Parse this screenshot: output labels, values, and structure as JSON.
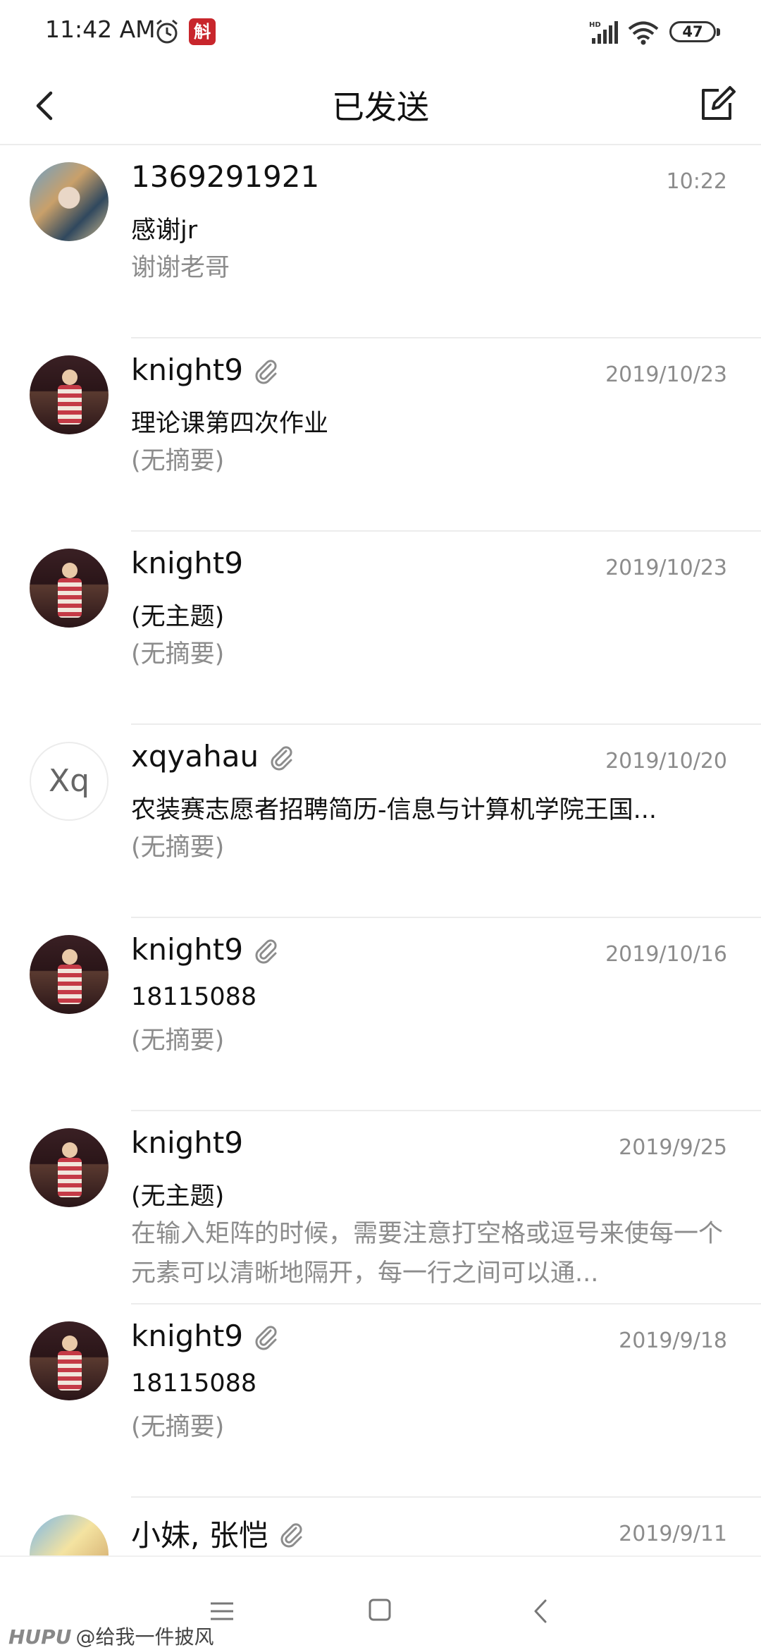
{
  "status_bar": {
    "time": "11:42 AM",
    "app_badge": "斛",
    "battery": "47",
    "icons": [
      "alarm-icon",
      "hd-signal-icon",
      "wifi-icon",
      "battery-icon"
    ]
  },
  "header": {
    "title": "已发送",
    "back_icon": "chevron-left-icon",
    "compose_icon": "compose-icon"
  },
  "messages": [
    {
      "sender": "1369291921",
      "date": "10:22",
      "subject": "感谢jr",
      "snippet": "谢谢老哥",
      "attachment": false,
      "avatar": "photo"
    },
    {
      "sender": "knight9",
      "date": "2019/10/23",
      "subject": "理论课第四次作业",
      "snippet": "(无摘要)",
      "attachment": true,
      "avatar": "photo"
    },
    {
      "sender": "knight9",
      "date": "2019/10/23",
      "subject": "(无主题)",
      "snippet": "(无摘要)",
      "attachment": false,
      "avatar": "photo"
    },
    {
      "sender": "xqyahau",
      "date": "2019/10/20",
      "subject": "农装赛志愿者招聘简历-信息与计算机学院王国...",
      "snippet": "(无摘要)",
      "attachment": true,
      "avatar": "Xq"
    },
    {
      "sender": "knight9",
      "date": "2019/10/16",
      "subject": "18115088",
      "snippet": "(无摘要)",
      "attachment": true,
      "avatar": "photo"
    },
    {
      "sender": "knight9",
      "date": "2019/9/25",
      "subject": "(无主题)",
      "snippet": "在输入矩阵的时候，需要注意打空格或逗号来使每一个元素可以清晰地隔开，每一行之间可以通...",
      "attachment": false,
      "avatar": "photo"
    },
    {
      "sender": "knight9",
      "date": "2019/9/18",
      "subject": "18115088",
      "snippet": "(无摘要)",
      "attachment": true,
      "avatar": "photo"
    },
    {
      "sender": "小妹, 张恺",
      "date": "2019/9/11",
      "subject": "",
      "snippet": "",
      "attachment": true,
      "avatar": "photo"
    }
  ],
  "nav": {
    "icons": [
      "menu-icon",
      "home-icon",
      "back-icon"
    ]
  },
  "watermark": {
    "brand": "HUPU",
    "text": "@给我一件披风"
  },
  "colors": {
    "text": "#111111",
    "secondary": "#8c8c8c",
    "divider": "#ececec",
    "badge": "#c8262c"
  }
}
